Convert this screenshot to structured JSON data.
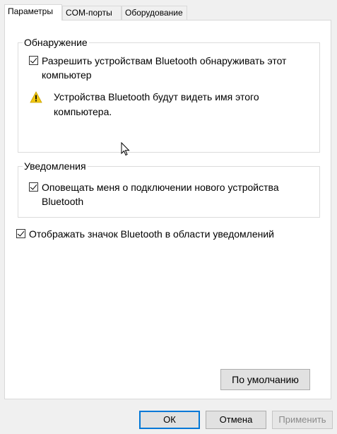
{
  "tabs": [
    {
      "label": "Параметры",
      "active": true
    },
    {
      "label": "COM-порты",
      "active": false
    },
    {
      "label": "Оборудование",
      "active": false
    }
  ],
  "discovery": {
    "legend": "Обнаружение",
    "allow_label": "Разрешить устройствам Bluetooth обнаруживать этот компьютер",
    "allow_checked": true,
    "warning_icon": "warning-icon",
    "warning_text": "Устройства Bluetooth будут видеть имя этого компьютера."
  },
  "notifications": {
    "legend": "Уведомления",
    "notify_label": "Оповещать меня о подключении нового устройства Bluetooth",
    "notify_checked": true
  },
  "show_icon": {
    "label": "Отображать значок Bluetooth в области уведомлений",
    "checked": true
  },
  "buttons": {
    "defaults": "По умолчанию",
    "ok": "ОК",
    "cancel": "Отмена",
    "apply": "Применить"
  },
  "colors": {
    "accent": "#0078d7",
    "warning": "#f2c811"
  }
}
